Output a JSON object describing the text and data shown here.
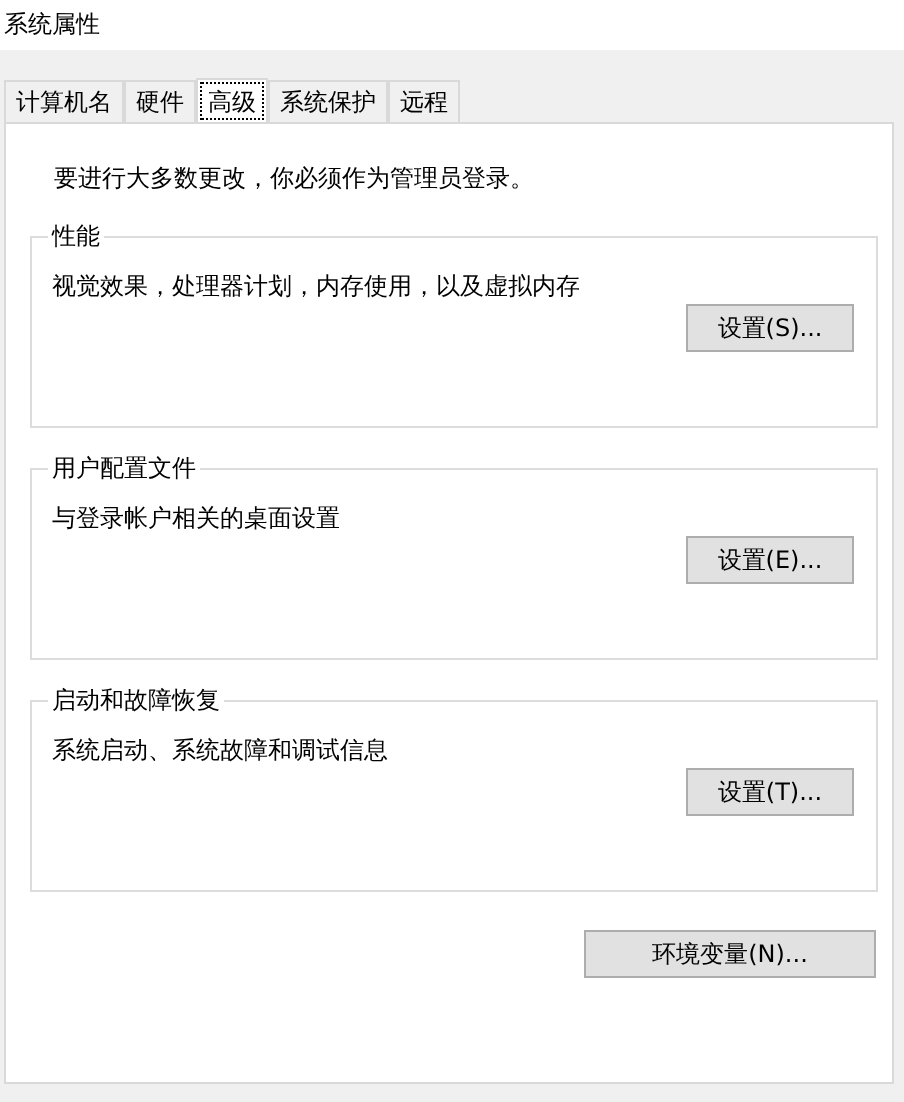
{
  "window": {
    "title": "系统属性"
  },
  "tabs": [
    {
      "label": "计算机名",
      "selected": false
    },
    {
      "label": "硬件",
      "selected": false
    },
    {
      "label": "高级",
      "selected": true
    },
    {
      "label": "系统保护",
      "selected": false
    },
    {
      "label": "远程",
      "selected": false
    }
  ],
  "notice": "要进行大多数更改，你必须作为管理员登录。",
  "groups": [
    {
      "title": "性能",
      "description": "视觉效果，处理器计划，内存使用，以及虚拟内存",
      "button": "设置(S)..."
    },
    {
      "title": "用户配置文件",
      "description": "与登录帐户相关的桌面设置",
      "button": "设置(E)..."
    },
    {
      "title": "启动和故障恢复",
      "description": "系统启动、系统故障和调试信息",
      "button": "设置(T)..."
    }
  ],
  "env_button": "环境变量(N)..."
}
